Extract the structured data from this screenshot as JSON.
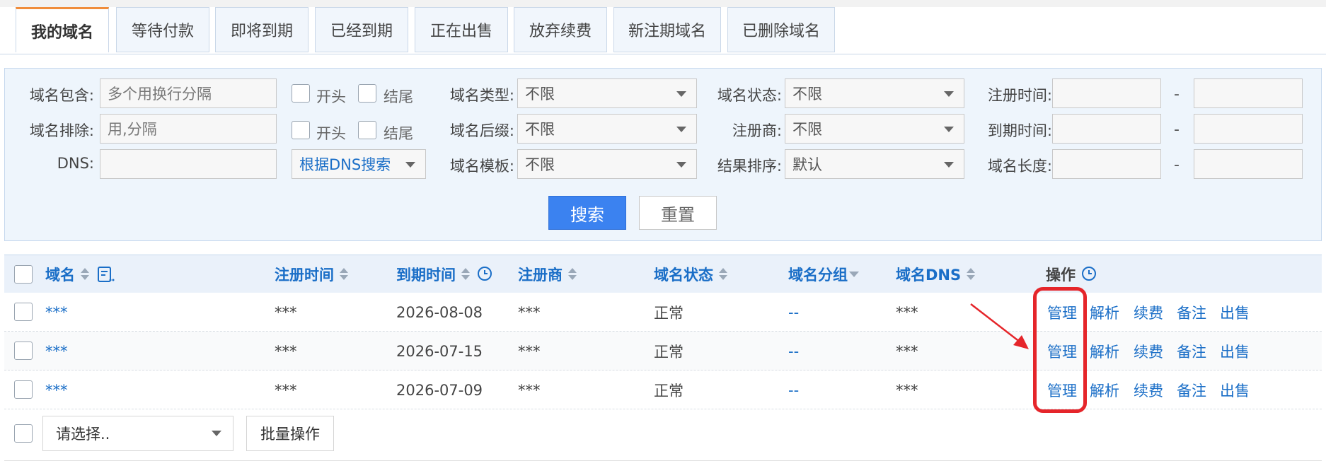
{
  "tabs": [
    "我的域名",
    "等待付款",
    "即将到期",
    "已经到期",
    "正在出售",
    "放弃续费",
    "新注期域名",
    "已删除域名"
  ],
  "filters": {
    "include_label": "域名包含:",
    "include_placeholder": "多个用换行分隔",
    "exclude_label": "域名排除:",
    "exclude_placeholder": "用,分隔",
    "dns_label": "DNS:",
    "start_label": "开头",
    "end_label": "结尾",
    "dns_search_mode": "根据DNS搜索",
    "type_label": "域名类型:",
    "type_value": "不限",
    "suffix_label": "域名后缀:",
    "suffix_value": "不限",
    "template_label": "域名模板:",
    "template_value": "不限",
    "status_label": "域名状态:",
    "status_value": "不限",
    "registrar_label": "注册商:",
    "registrar_value": "不限",
    "sort_label": "结果排序:",
    "sort_value": "默认",
    "reg_time_label": "注册时间:",
    "exp_time_label": "到期时间:",
    "length_label": "域名长度:",
    "range_sep": "-",
    "search_button": "搜索",
    "reset_button": "重置"
  },
  "table": {
    "headers": {
      "domain": "域名",
      "reg_time": "注册时间",
      "exp_time": "到期时间",
      "registrar": "注册商",
      "status": "域名状态",
      "group": "域名分组",
      "dns": "域名DNS",
      "ops": "操作"
    },
    "rows": [
      {
        "domain": "***",
        "reg_time": "***",
        "exp_time": "2026-08-08",
        "registrar": "***",
        "status": "正常",
        "group": "--",
        "dns": "***"
      },
      {
        "domain": "***",
        "reg_time": "***",
        "exp_time": "2026-07-15",
        "registrar": "***",
        "status": "正常",
        "group": "--",
        "dns": "***"
      },
      {
        "domain": "***",
        "reg_time": "***",
        "exp_time": "2026-07-09",
        "registrar": "***",
        "status": "正常",
        "group": "--",
        "dns": "***"
      }
    ],
    "row_actions": [
      "管理",
      "解析",
      "续费",
      "备注",
      "出售"
    ]
  },
  "footer": {
    "select_placeholder": "请选择..",
    "batch_button": "批量操作"
  },
  "colors": {
    "accent": "#1a6ec7",
    "primary_button": "#3b82f0",
    "tab_active_border": "#f08c3a",
    "annotation": "#e5252a"
  }
}
